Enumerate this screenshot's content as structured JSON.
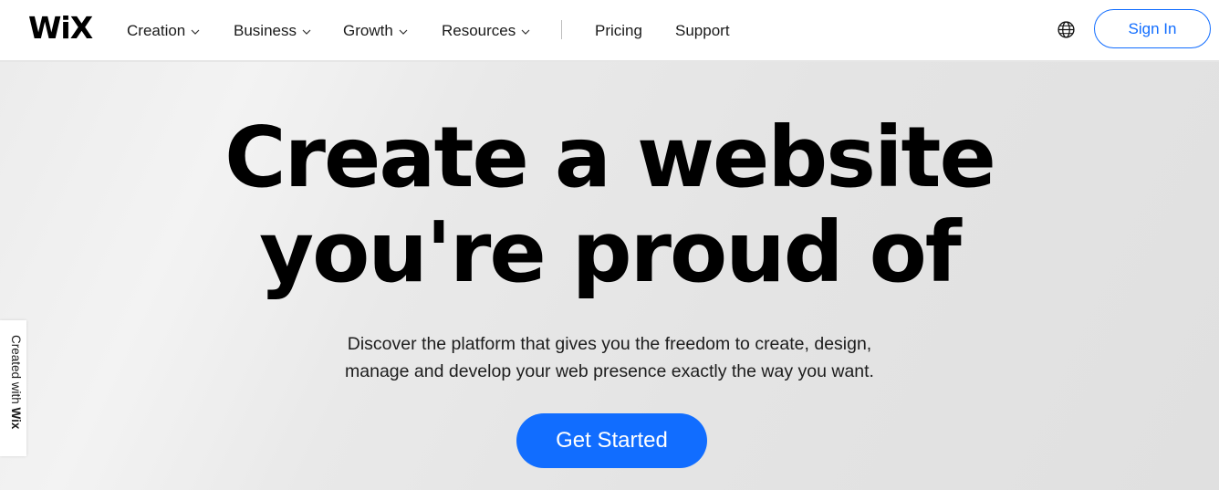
{
  "header": {
    "logo": "WiX",
    "nav": [
      {
        "label": "Creation",
        "dropdown": true,
        "icon": "chevron-down-icon"
      },
      {
        "label": "Business",
        "dropdown": true,
        "icon": "chevron-down-icon"
      },
      {
        "label": "Growth",
        "dropdown": true,
        "icon": "chevron-down-icon"
      },
      {
        "label": "Resources",
        "dropdown": true,
        "icon": "chevron-down-icon"
      },
      {
        "label": "Pricing",
        "dropdown": false
      },
      {
        "label": "Support",
        "dropdown": false
      }
    ],
    "language_icon": "globe-icon",
    "signin_label": "Sign In"
  },
  "hero": {
    "headline_line1": "Create a website",
    "headline_line2": "you're proud of",
    "subtitle_line1": "Discover the platform that gives you the freedom to create, design,",
    "subtitle_line2": "manage and develop your web presence exactly the way you want.",
    "cta_label": "Get Started"
  },
  "badge": {
    "prefix": "Created with ",
    "brand": "Wix"
  },
  "colors": {
    "accent": "#116dff",
    "text": "#000000",
    "background": "#e6e6e6"
  }
}
